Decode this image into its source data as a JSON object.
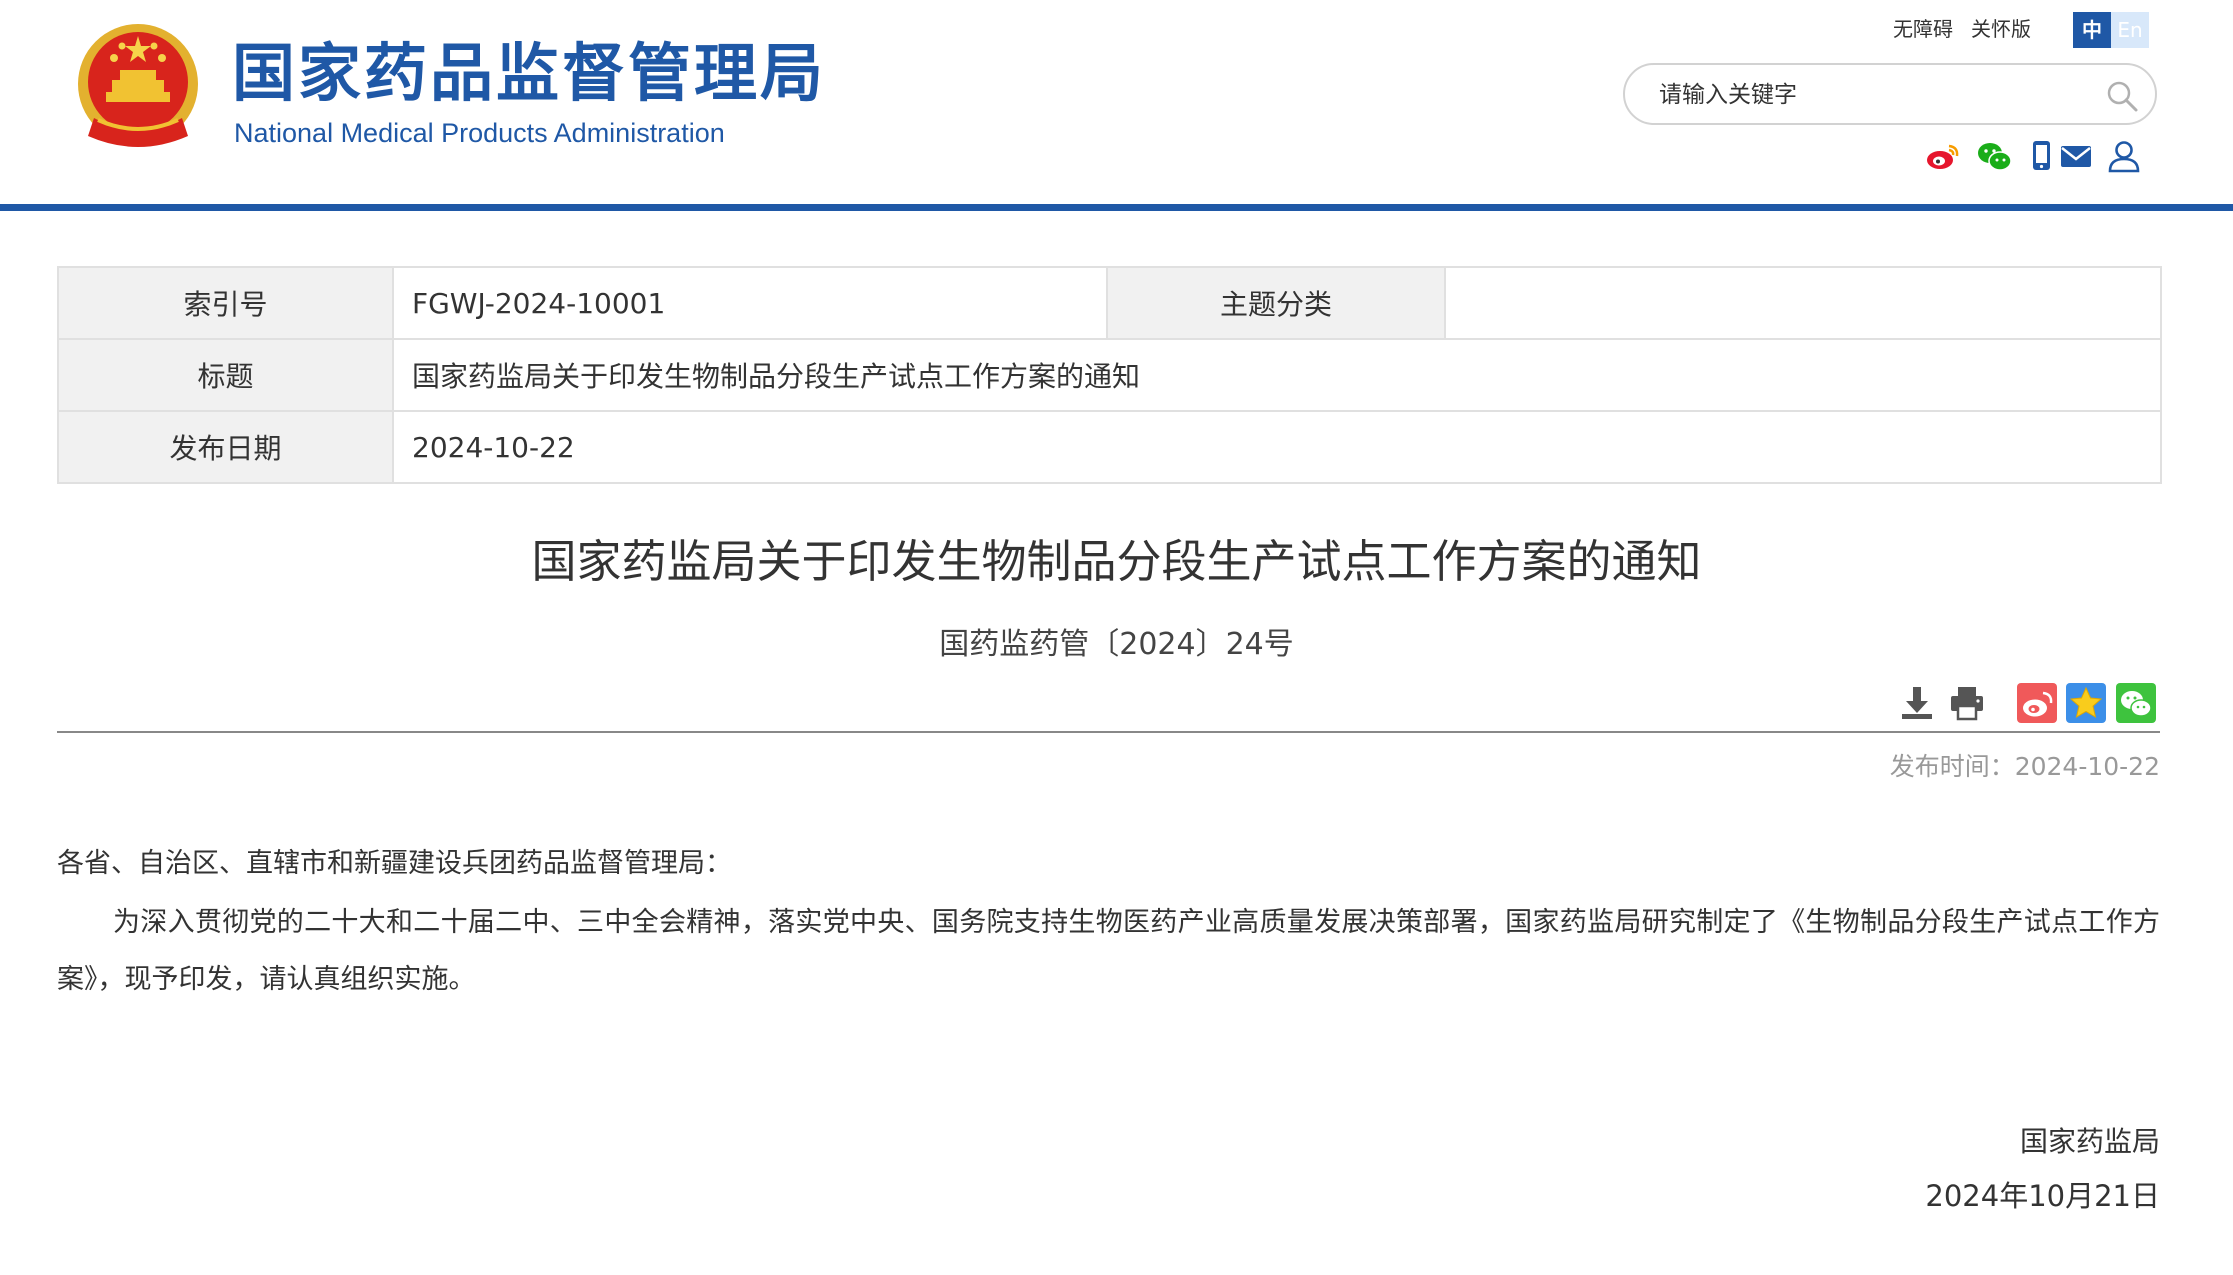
{
  "header": {
    "cn_title": "国家药品监督管理局",
    "en_title": "National Medical Products Administration",
    "links": {
      "accessible": "无障碍",
      "elder": "关怀版"
    },
    "lang": {
      "cn": "中",
      "en": "En"
    },
    "search": {
      "placeholder": "请输入关键字"
    },
    "social_icons": [
      "weibo-icon",
      "wechat-icon",
      "mobile-icon",
      "mail-icon",
      "user-icon"
    ],
    "brand_color": "#1f58a6"
  },
  "meta": {
    "index_label": "索引号",
    "index_value": "FGWJ-2024-10001",
    "topic_label": "主题分类",
    "topic_value": "",
    "title_label": "标题",
    "title_value": "国家药监局关于印发生物制品分段生产试点工作方案的通知",
    "date_label": "发布日期",
    "date_value": "2024-10-22"
  },
  "article": {
    "title": "国家药监局关于印发生物制品分段生产试点工作方案的通知",
    "doc_number": "国药监药管〔2024〕24号",
    "tools": [
      "download-icon",
      "print-icon",
      "weibo-share-icon",
      "favorite-icon",
      "wechat-share-icon"
    ],
    "publish_time_label": "发布时间：",
    "publish_time_value": "2024-10-22",
    "salutation": "各省、自治区、直辖市和新疆建设兵团药品监督管理局：",
    "paragraph": "为深入贯彻党的二十大和二十届二中、三中全会精神，落实党中央、国务院支持生物医药产业高质量发展决策部署，国家药监局研究制定了《生物制品分段生产试点工作方案》，现予印发，请认真组织实施。",
    "sign_agency": "国家药监局",
    "sign_date": "2024年10月21日"
  }
}
